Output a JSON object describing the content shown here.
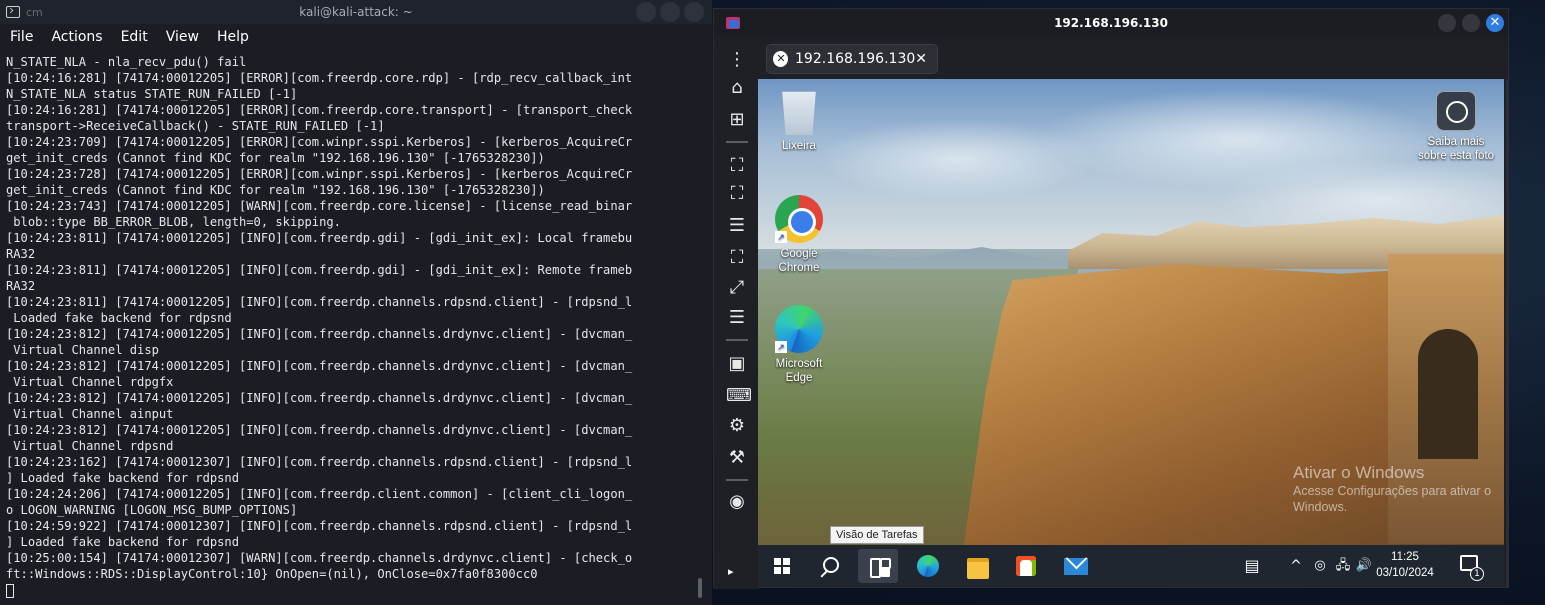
{
  "terminal": {
    "title": "kali@kali-attack: ~",
    "small_label": "cm",
    "menu": [
      "File",
      "Actions",
      "Edit",
      "View",
      "Help"
    ],
    "lines": [
      "N_STATE_NLA - nla_recv_pdu() fail",
      "[10:24:16:281] [74174:00012205] [ERROR][com.freerdp.core.rdp] - [rdp_recv_callback_int",
      "N_STATE_NLA status STATE_RUN_FAILED [-1]",
      "[10:24:16:281] [74174:00012205] [ERROR][com.freerdp.core.transport] - [transport_check",
      "transport->ReceiveCallback() - STATE_RUN_FAILED [-1]",
      "[10:24:23:709] [74174:00012205] [ERROR][com.winpr.sspi.Kerberos] - [kerberos_AcquireCr",
      "get_init_creds (Cannot find KDC for realm \"192.168.196.130\" [-1765328230])",
      "[10:24:23:728] [74174:00012205] [ERROR][com.winpr.sspi.Kerberos] - [kerberos_AcquireCr",
      "get_init_creds (Cannot find KDC for realm \"192.168.196.130\" [-1765328230])",
      "[10:24:23:743] [74174:00012205] [WARN][com.freerdp.core.license] - [license_read_binar",
      " blob::type BB_ERROR_BLOB, length=0, skipping.",
      "[10:24:23:811] [74174:00012205] [INFO][com.freerdp.gdi] - [gdi_init_ex]: Local framebu",
      "RA32",
      "[10:24:23:811] [74174:00012205] [INFO][com.freerdp.gdi] - [gdi_init_ex]: Remote frameb",
      "RA32",
      "[10:24:23:811] [74174:00012205] [INFO][com.freerdp.channels.rdpsnd.client] - [rdpsnd_l",
      " Loaded fake backend for rdpsnd",
      "[10:24:23:812] [74174:00012205] [INFO][com.freerdp.channels.drdynvc.client] - [dvcman_",
      " Virtual Channel disp",
      "[10:24:23:812] [74174:00012205] [INFO][com.freerdp.channels.drdynvc.client] - [dvcman_",
      " Virtual Channel rdpgfx",
      "[10:24:23:812] [74174:00012205] [INFO][com.freerdp.channels.drdynvc.client] - [dvcman_",
      " Virtual Channel ainput",
      "[10:24:23:812] [74174:00012205] [INFO][com.freerdp.channels.drdynvc.client] - [dvcman_",
      " Virtual Channel rdpsnd",
      "[10:24:23:162] [74174:00012307] [INFO][com.freerdp.channels.rdpsnd.client] - [rdpsnd_l",
      "] Loaded fake backend for rdpsnd",
      "[10:24:24:206] [74174:00012205] [INFO][com.freerdp.client.common] - [client_cli_logon_",
      "o LOGON_WARNING [LOGON_MSG_BUMP_OPTIONS]",
      "[10:24:59:922] [74174:00012307] [INFO][com.freerdp.channels.rdpsnd.client] - [rdpsnd_l",
      "] Loaded fake backend for rdpsnd",
      "[10:25:00:154] [74174:00012307] [WARN][com.freerdp.channels.drdynvc.client] - [check_o",
      "ft::Windows::RDS::DisplayControl:10} OnOpen=(nil), OnClose=0x7fa0f8300cc0"
    ]
  },
  "remote": {
    "window_title": "192.168.196.130",
    "tab_label": "192.168.196.130",
    "tab_close": "✕",
    "close_glyph": "✕",
    "toolbar_icons": [
      "more-vert-icon",
      "home-icon",
      "new-tab-icon",
      "fit-window-icon",
      "fullscreen-icon",
      "menu-icon",
      "scaled-icon",
      "dynamic-resize-icon",
      "menu-icon",
      "multi-monitor-icon",
      "keyboard-icon",
      "settings-icon",
      "tools-icon",
      "screenshot-icon"
    ],
    "expand_glyph": "▸",
    "desktop": {
      "icons": [
        {
          "label": "Lixeira"
        },
        {
          "label": "Google Chrome"
        },
        {
          "label": "Microsoft Edge"
        }
      ],
      "photo_icon_label": "Saiba mais sobre esta foto",
      "activate_title": "Ativar o Windows",
      "activate_sub": "Acesse Configurações para ativar o Windows.",
      "tooltip": "Visão de Tarefas"
    },
    "taskbar": {
      "time": "11:25",
      "date": "03/10/2024",
      "notification_count": "1",
      "tray": {
        "chevron": "^",
        "volume": "🔊"
      }
    }
  }
}
